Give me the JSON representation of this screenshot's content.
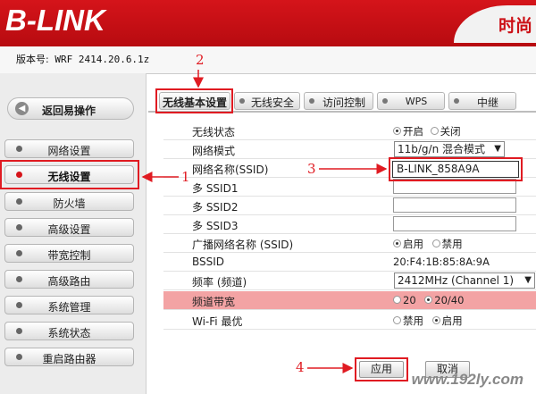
{
  "header": {
    "logo": "B-LINK",
    "right_fragment": "时尚",
    "version_label": "版本号:",
    "version_value": "WRF 2414.20.6.1z"
  },
  "sidebar": {
    "back_label": "返回易操作",
    "items": [
      {
        "label": "网络设置",
        "active": false
      },
      {
        "label": "无线设置",
        "active": true
      },
      {
        "label": "防火墙",
        "active": false
      },
      {
        "label": "高级设置",
        "active": false
      },
      {
        "label": "带宽控制",
        "active": false
      },
      {
        "label": "高级路由",
        "active": false
      },
      {
        "label": "系统管理",
        "active": false
      },
      {
        "label": "系统状态",
        "active": false
      },
      {
        "label": "重启路由器",
        "active": false
      }
    ]
  },
  "tabs": [
    {
      "label": "无线基本设置",
      "active": true
    },
    {
      "label": "无线安全",
      "active": false
    },
    {
      "label": "访问控制",
      "active": false
    },
    {
      "label": "WPS",
      "active": false
    },
    {
      "label": "中继",
      "active": false
    }
  ],
  "form": {
    "wireless_status": {
      "label": "无线状态",
      "options": [
        "开启",
        "关闭"
      ],
      "selected": "开启"
    },
    "network_mode": {
      "label": "网络模式",
      "value": "11b/g/n 混合模式"
    },
    "ssid": {
      "label": "网络名称(SSID)",
      "value": "B-LINK_858A9A"
    },
    "ssid1": {
      "label": "多 SSID1",
      "value": ""
    },
    "ssid2": {
      "label": "多 SSID2",
      "value": ""
    },
    "ssid3": {
      "label": "多 SSID3",
      "value": ""
    },
    "broadcast": {
      "label": "广播网络名称 (SSID)",
      "options": [
        "启用",
        "禁用"
      ],
      "selected": "启用"
    },
    "bssid": {
      "label": "BSSID",
      "value": "20:F4:1B:85:8A:9A"
    },
    "channel": {
      "label": "频率 (频道)",
      "value": "2412MHz (Channel 1)"
    },
    "bandwidth": {
      "label": "频道带宽",
      "options": [
        "20",
        "20/40"
      ],
      "selected": "20/40"
    },
    "wifi_optimize": {
      "label": "Wi-Fi 最优",
      "options": [
        "禁用",
        "启用"
      ],
      "selected": "启用"
    }
  },
  "buttons": {
    "apply": "应用",
    "cancel": "取消"
  },
  "annotations": {
    "n1": "1",
    "n2": "2",
    "n3": "3",
    "n4": "4"
  },
  "watermark": "www.192ly.com",
  "colors": {
    "brand_red": "#d5141a",
    "annotation_red": "#e01b22",
    "highlight_row": "#f3a3a4"
  }
}
